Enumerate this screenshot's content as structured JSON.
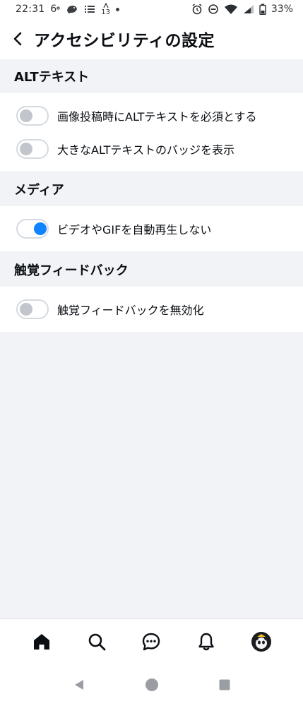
{
  "status_bar": {
    "time": "22:31",
    "weather_temp": "6",
    "badge_count": "13",
    "battery": "33%"
  },
  "header": {
    "title": "アクセシビリティの設定"
  },
  "sections": [
    {
      "title": "ALTテキスト",
      "items": [
        {
          "label": "画像投稿時にALTテキストを必須とする",
          "enabled": false
        },
        {
          "label": "大きなALTテキストのバッジを表示",
          "enabled": false
        }
      ]
    },
    {
      "title": "メディア",
      "items": [
        {
          "label": "ビデオやGIFを自動再生しない",
          "enabled": true
        }
      ]
    },
    {
      "title": "触覚フィードバック",
      "items": [
        {
          "label": "触覚フィードバックを無効化",
          "enabled": false
        }
      ]
    }
  ],
  "colors": {
    "accent": "#1083fe",
    "background": "#f1f3f6",
    "surface": "#ffffff",
    "toggle_off_knob": "#c2c6cc"
  },
  "icons": {
    "back": "arrow-left-icon",
    "home": "home-icon",
    "search": "search-icon",
    "chat": "chat-icon",
    "notifications": "bell-icon"
  }
}
